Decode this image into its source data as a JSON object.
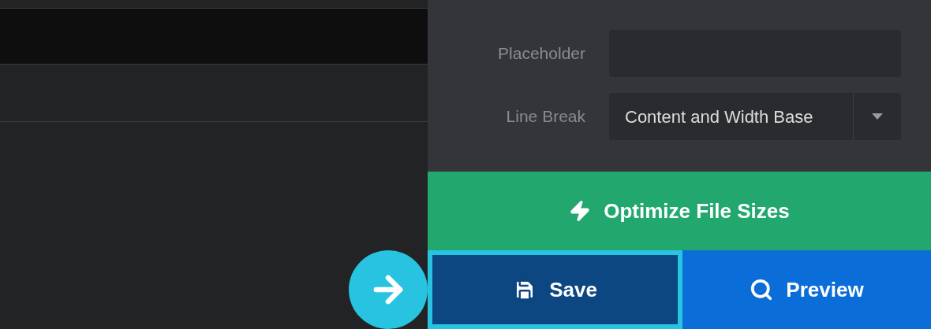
{
  "fields": [
    {
      "label": "Placeholder",
      "kind": "input"
    },
    {
      "label": "Line Break",
      "kind": "select",
      "value": "Content and Width Base"
    }
  ],
  "optimize_button": {
    "label": "Optimize File Sizes"
  },
  "actions": [
    {
      "label": "Save",
      "kind": "save",
      "selected": true
    },
    {
      "label": "Preview",
      "kind": "preview",
      "selected": false
    }
  ]
}
